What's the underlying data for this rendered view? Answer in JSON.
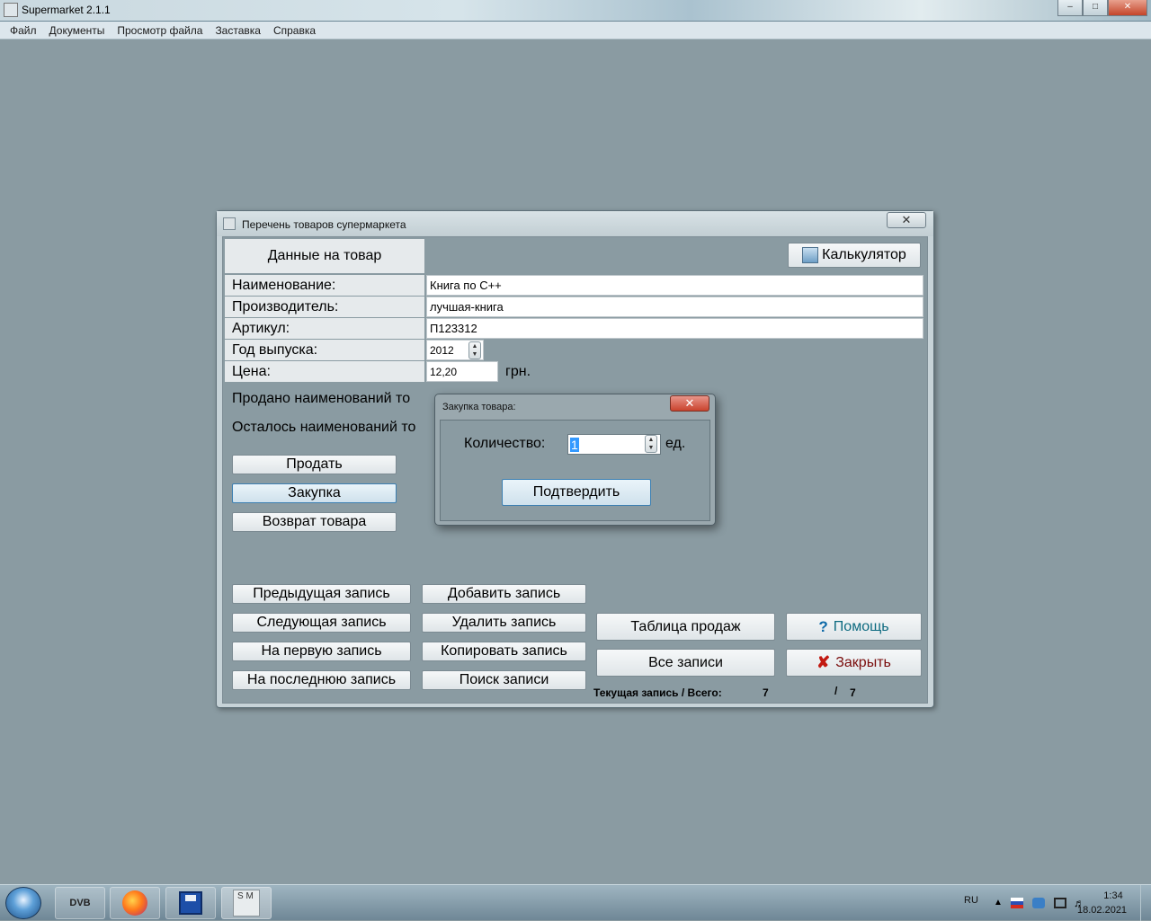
{
  "app": {
    "title": "Supermarket 2.1.1",
    "icon_text": "SM"
  },
  "menu": [
    "Файл",
    "Документы",
    "Просмотр файла",
    "Заставка",
    "Справка"
  ],
  "form": {
    "title": "Перечень товаров супермаркета",
    "header_label": "Данные на товар",
    "calculator_label": "Калькулятор",
    "fields": {
      "name": {
        "label": "Наименование:",
        "value": "Книга по С++"
      },
      "manufacturer": {
        "label": "Производитель:",
        "value": "лучшая-книга"
      },
      "article": {
        "label": "Артикул:",
        "value": "П123312"
      },
      "year": {
        "label": "Год  выпуска:",
        "value": "2012"
      },
      "price": {
        "label": "Цена:",
        "value": "12,20",
        "unit": "грн."
      }
    },
    "sold_label": "Продано  наименований  то",
    "remaining_label": "Осталось  наименований  то",
    "buttons": {
      "sell": "Продать",
      "purchase": "Закупка",
      "return": "Возврат  товара",
      "prev": "Предыдущая  запись",
      "next": "Следующая  запись",
      "first": "На  первую  запись",
      "last": "На  последнюю  запись",
      "add": "Добавить  запись",
      "delete": "Удалить  запись",
      "copy": "Копировать  запись",
      "search": "Поиск  записи",
      "sales_table": "Таблица  продаж",
      "all_records": "Все  записи",
      "help": "Помощь",
      "close": "Закрыть"
    },
    "status": {
      "label": "Текущая  запись / Всего:",
      "current": "7",
      "separator": "/",
      "total": "7"
    }
  },
  "dialog": {
    "title": "Закупка товара:",
    "quantity_label": "Количество:",
    "quantity_value": "1",
    "unit": "ед.",
    "confirm_label": "Подтвердить"
  },
  "taskbar": {
    "dvb_label": "DVB",
    "sm_label": "S M",
    "lang": "RU",
    "time": "1:34",
    "date": "18.02.2021"
  },
  "colors": {
    "workspace": "#8a9ba2",
    "help_accent": "#0e6aa8",
    "close_accent": "#c21a12",
    "selection": "#3399ff"
  }
}
